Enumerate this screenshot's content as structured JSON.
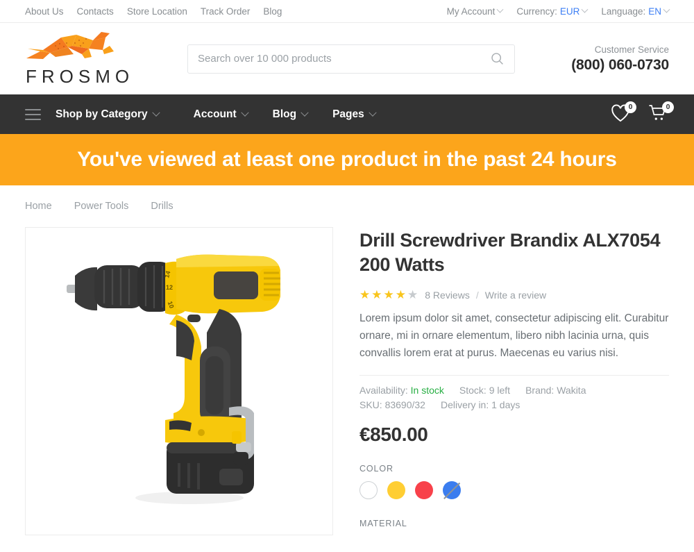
{
  "topbar": {
    "links": [
      {
        "label": "About Us"
      },
      {
        "label": "Contacts"
      },
      {
        "label": "Store Location"
      },
      {
        "label": "Track Order"
      },
      {
        "label": "Blog"
      }
    ],
    "account_label": "My Account",
    "currency_label": "Currency:",
    "currency_value": "EUR",
    "language_label": "Language:",
    "language_value": "EN"
  },
  "header": {
    "logo_text": "FROSMO",
    "search_placeholder": "Search over 10 000 products",
    "search_value": "",
    "customer_service_label": "Customer Service",
    "phone": "(800) 060-0730"
  },
  "nav": {
    "items": [
      {
        "label": "Shop by Category"
      },
      {
        "label": "Account"
      },
      {
        "label": "Blog"
      },
      {
        "label": "Pages"
      }
    ],
    "wishlist_count": "0",
    "cart_count": "0"
  },
  "banner": {
    "text": "You've viewed at least one product in the past 24 hours"
  },
  "breadcrumb": {
    "items": [
      {
        "label": "Home"
      },
      {
        "label": "Power Tools"
      },
      {
        "label": "Drills"
      }
    ]
  },
  "product": {
    "title": "Drill Screwdriver Brandix ALX7054 200 Watts",
    "rating_filled": 4,
    "rating_total": 5,
    "reviews_text": "8 Reviews",
    "reviews_separator": "/",
    "write_review_label": "Write a review",
    "description": "Lorem ipsum dolor sit amet, consectetur adipiscing elit. Curabitur ornare, mi in ornare elementum, libero nibh lacinia urna, quis convallis lorem erat at purus. Maecenas eu varius nisi.",
    "availability_label": "Availability:",
    "availability_value": "In stock",
    "stock_label": "Stock:",
    "stock_value": "9 left",
    "brand_label": "Brand:",
    "brand_value": "Wakita",
    "sku_label": "SKU:",
    "sku_value": "83690/32",
    "delivery_label": "Delivery in:",
    "delivery_value": "1 days",
    "price": "€850.00",
    "color_label": "COLOR",
    "colors": [
      {
        "name": "white",
        "hex": "#ffffff",
        "unavailable": false
      },
      {
        "name": "yellow",
        "hex": "#ffce33",
        "unavailable": false
      },
      {
        "name": "red",
        "hex": "#f8414a",
        "unavailable": false
      },
      {
        "name": "blue",
        "hex": "#3b7def",
        "unavailable": true
      }
    ],
    "material_label": "MATERIAL"
  },
  "theme": {
    "accent_orange": "#fca51b",
    "nav_dark": "#333333",
    "link_blue": "#3d7ff5",
    "in_stock_green": "#27ae43",
    "star_gold": "#f9c51d"
  }
}
